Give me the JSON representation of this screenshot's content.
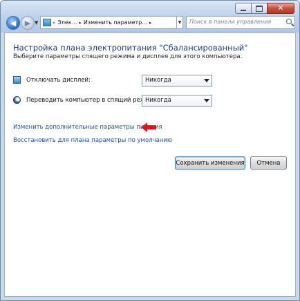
{
  "address_bar": {
    "overflow": "«",
    "crumbs": [
      "Элек...",
      "Изменить параметр..."
    ],
    "separator": "▸"
  },
  "search": {
    "placeholder": "Поиск в панели управления"
  },
  "page": {
    "heading": "Настройка плана электропитания \"Сбалансированный\"",
    "subtitle": "Выберите параметры спящего режима и дисплея для этого компьютера."
  },
  "settings": [
    {
      "label": "Отключать дисплей:",
      "value": "Никогда",
      "icon": "monitor-icon"
    },
    {
      "label": "Переводить компьютер в спящий режим:",
      "value": "Никогда",
      "icon": "sleep-moon-icon"
    }
  ],
  "links": {
    "advanced": "Изменить дополнительные параметры питания",
    "restore": "Восстановить для плана параметры по умолчанию"
  },
  "buttons": {
    "save": "Сохранить изменения",
    "cancel": "Отмена"
  },
  "annotation": {
    "icon": "red-arrow-icon",
    "color": "#e0141c"
  }
}
